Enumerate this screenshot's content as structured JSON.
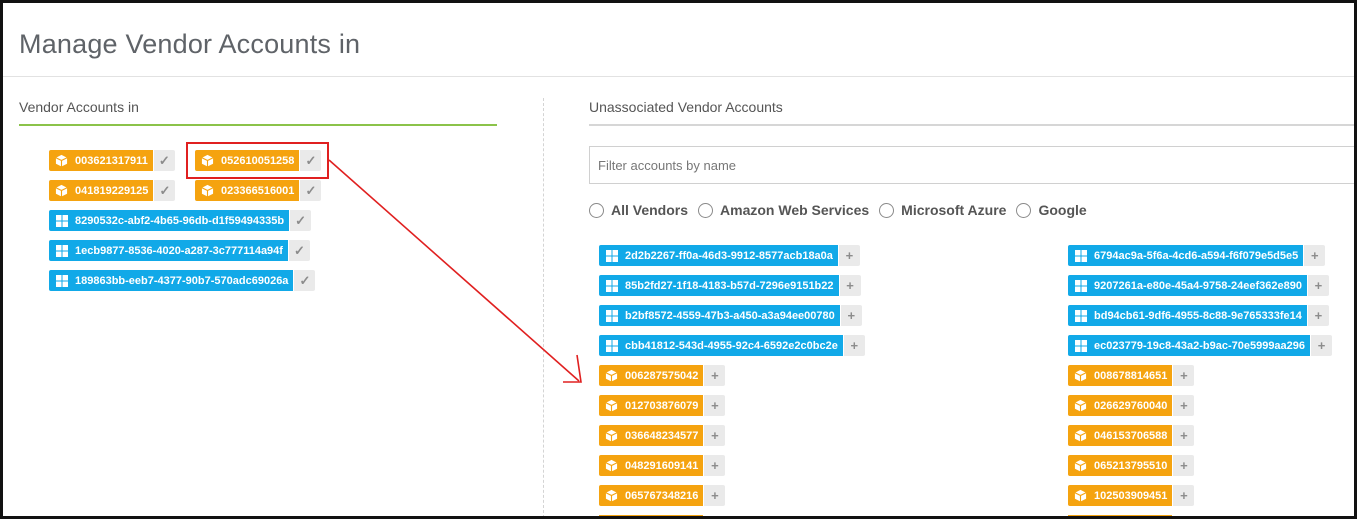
{
  "page": {
    "title": "Manage Vendor Accounts in"
  },
  "left_panel": {
    "heading": "Vendor Accounts in",
    "accounts": [
      {
        "label": "003621317911",
        "vendor": "aws",
        "icon": "package-icon"
      },
      {
        "label": "052610051258",
        "vendor": "aws",
        "icon": "package-icon"
      },
      {
        "label": "041819229125",
        "vendor": "aws",
        "icon": "package-icon"
      },
      {
        "label": "023366516001",
        "vendor": "aws",
        "icon": "package-icon"
      },
      {
        "label": "8290532c-abf2-4b65-96db-d1f59494335b",
        "vendor": "azure",
        "icon": "windows-icon"
      },
      {
        "label": "1ecb9877-8536-4020-a287-3c777114a94f",
        "vendor": "azure",
        "icon": "windows-icon"
      },
      {
        "label": "189863bb-eeb7-4377-90b7-570adc69026a",
        "vendor": "azure",
        "icon": "windows-icon"
      }
    ],
    "action_glyph": "✓"
  },
  "right_panel": {
    "heading": "Unassociated Vendor Accounts",
    "filter": {
      "value": "",
      "placeholder": "Filter accounts by name"
    },
    "vendor_filters": [
      {
        "label": "All Vendors"
      },
      {
        "label": "Amazon Web Services"
      },
      {
        "label": "Microsoft Azure"
      },
      {
        "label": "Google"
      }
    ],
    "column_1": [
      {
        "label": "2d2b2267-ff0a-46d3-9912-8577acb18a0a",
        "vendor": "azure"
      },
      {
        "label": "85b2fd27-1f18-4183-b57d-7296e9151b22",
        "vendor": "azure"
      },
      {
        "label": "b2bf8572-4559-47b3-a450-a3a94ee00780",
        "vendor": "azure"
      },
      {
        "label": "cbb41812-543d-4955-92c4-6592e2c0bc2e",
        "vendor": "azure"
      },
      {
        "label": "006287575042",
        "vendor": "aws"
      },
      {
        "label": "012703876079",
        "vendor": "aws"
      },
      {
        "label": "036648234577",
        "vendor": "aws"
      },
      {
        "label": "048291609141",
        "vendor": "aws"
      },
      {
        "label": "065767348216",
        "vendor": "aws"
      }
    ],
    "column_2": [
      {
        "label": "6794ac9a-5f6a-4cd6-a594-f6f079e5d5e5",
        "vendor": "azure"
      },
      {
        "label": "9207261a-e80e-45a4-9758-24eef362e890",
        "vendor": "azure"
      },
      {
        "label": "bd94cb61-9df6-4955-8c88-9e765333fe14",
        "vendor": "azure"
      },
      {
        "label": "ec023779-19c8-43a2-b9ac-70e5999aa296",
        "vendor": "azure"
      },
      {
        "label": "008678814651",
        "vendor": "aws"
      },
      {
        "label": "026629760040",
        "vendor": "aws"
      },
      {
        "label": "046153706588",
        "vendor": "aws"
      },
      {
        "label": "065213795510",
        "vendor": "aws"
      },
      {
        "label": "102503909451",
        "vendor": "aws"
      }
    ],
    "action_glyph": "+"
  },
  "colors": {
    "aws": "#f5a30f",
    "azure": "#11a9e8",
    "accent_rule": "#8bc34a",
    "annotation": "#e02020"
  }
}
